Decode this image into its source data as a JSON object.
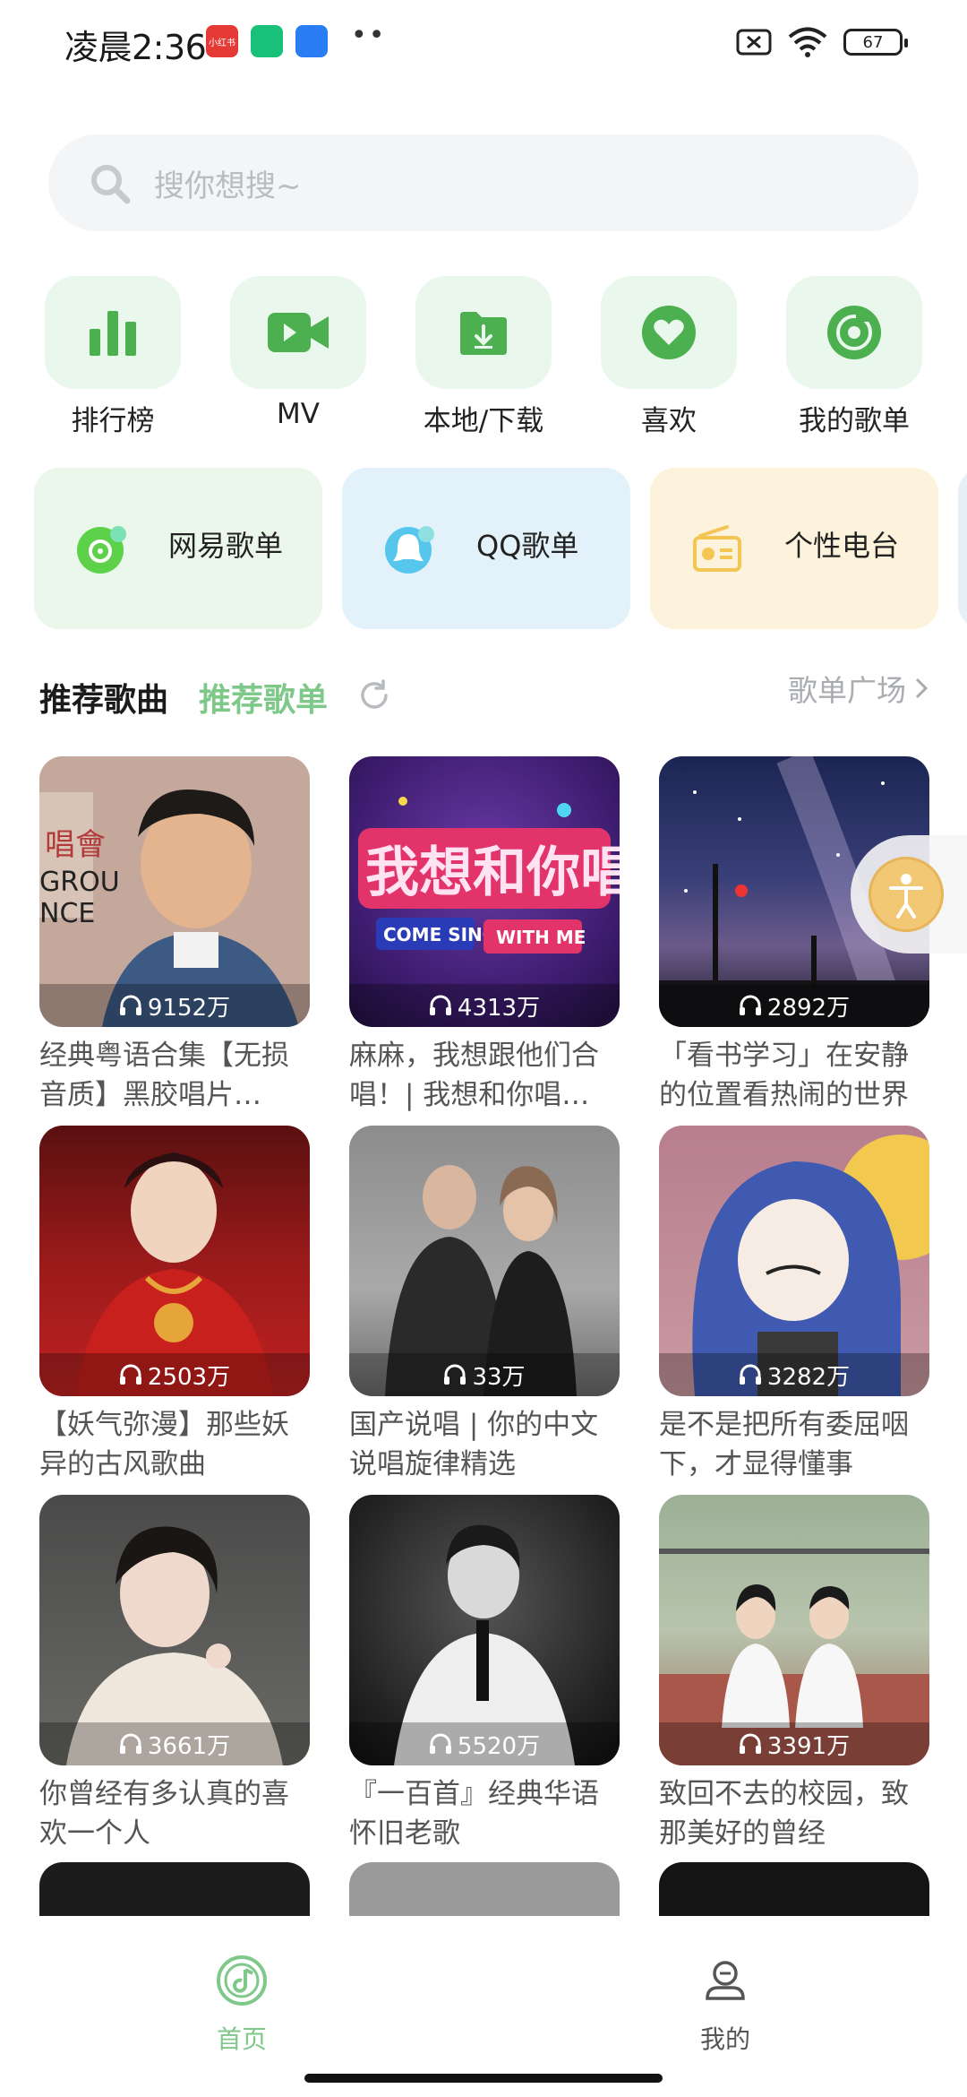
{
  "status_bar": {
    "time": "凌晨2:36",
    "app_badge_text": "小红书",
    "dots": "••",
    "battery": "67"
  },
  "search": {
    "placeholder": "搜你想搜~"
  },
  "quick_entries": [
    {
      "label": "排行榜",
      "icon": "bar-chart-icon"
    },
    {
      "label": "MV",
      "icon": "video-camera-icon"
    },
    {
      "label": "本地/下载",
      "icon": "download-folder-icon"
    },
    {
      "label": "喜欢",
      "icon": "heart-icon"
    },
    {
      "label": "我的歌单",
      "icon": "disc-icon"
    }
  ],
  "category_cards": [
    {
      "label": "网易歌单",
      "icon": "netease-icon",
      "color": "#eaf7ea"
    },
    {
      "label": "QQ歌单",
      "icon": "qq-icon",
      "color": "#e3f2fa"
    },
    {
      "label": "个性电台",
      "icon": "radio-icon",
      "color": "#fdf3dc"
    }
  ],
  "section": {
    "tab_active": "推荐歌曲",
    "tab_inactive": "推荐歌单",
    "more": "歌单广场",
    "accent": "#7ec88a"
  },
  "playlists": [
    {
      "plays": "9152万",
      "name": "经典粤语合集【无损音质】黑胶唱片…"
    },
    {
      "plays": "4313万",
      "name": "麻麻，我想跟他们合唱！| 我想和你唱…"
    },
    {
      "plays": "2892万",
      "name": "「看书学习」在安静的位置看热闹的世界"
    },
    {
      "plays": "2503万",
      "name": "【妖气弥漫】那些妖异的古风歌曲"
    },
    {
      "plays": "33万",
      "name": "国产说唱 | 你的中文说唱旋律精选"
    },
    {
      "plays": "3282万",
      "name": "是不是把所有委屈咽下，才显得懂事"
    },
    {
      "plays": "3661万",
      "name": "你曾经有多认真的喜欢一个人"
    },
    {
      "plays": "5520万",
      "name": "『一百首』经典华语怀旧老歌"
    },
    {
      "plays": "3391万",
      "name": "致回不去的校园，致那美好的曾经"
    }
  ],
  "bottom_nav": [
    {
      "label": "首页",
      "active": true,
      "color": "#7ec88a"
    },
    {
      "label": "我的",
      "active": false,
      "color": "#555555"
    }
  ]
}
